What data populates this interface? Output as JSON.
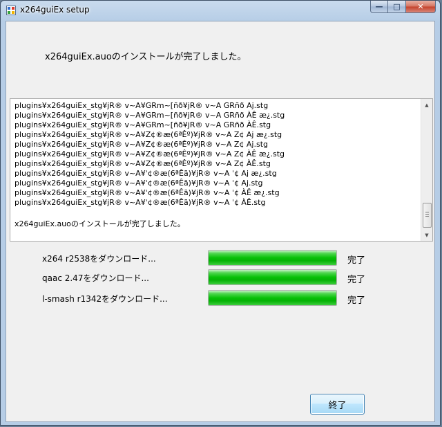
{
  "window": {
    "title": "x264guiEx setup",
    "caption": {
      "minimize": "—",
      "maximize": "□",
      "close": "✕"
    }
  },
  "header": {
    "message": "x264guiEx.auoのインストールが完了しました。"
  },
  "log": {
    "lines": [
      "plugins¥x264guiEx_stg¥jR® v~A¥GRm~[ñð¥jR® v~A GRñð Aj.stg",
      "plugins¥x264guiEx_stg¥jR® v~A¥GRm~[ñð¥jR® v~A GRñð ÀÊ æ¿.stg",
      "plugins¥x264guiEx_stg¥jR® v~A¥GRm~[ñð¥jR® v~A GRñð ÀÊ.stg",
      "plugins¥x264guiEx_stg¥jR® v~A¥Z¢®æ(6ªÊº)¥jR® v~A Z¢ Aj æ¿.stg",
      "plugins¥x264guiEx_stg¥jR® v~A¥Z¢®æ(6ªÊº)¥jR® v~A Z¢ Aj.stg",
      "plugins¥x264guiEx_stg¥jR® v~A¥Z¢®æ(6ªÊº)¥jR® v~A Z¢ ÀÊ æ¿.stg",
      "plugins¥x264guiEx_stg¥jR® v~A¥Z¢®æ(6ªÊº)¥jR® v~A Z¢ ÀÊ.stg",
      "plugins¥x264guiEx_stg¥jR® v~A¥ˈ¢®æ(6ªÊã)¥jR® v~A ˈ¢ Aj æ¿.stg",
      "plugins¥x264guiEx_stg¥jR® v~A¥ˈ¢®æ(6ªÊã)¥jR® v~A ˈ¢ Aj.stg",
      "plugins¥x264guiEx_stg¥jR® v~A¥ˈ¢®æ(6ªÊã)¥jR® v~A ˈ¢ ÀÊ æ¿.stg",
      "plugins¥x264guiEx_stg¥jR® v~A¥ˈ¢®æ(6ªÊã)¥jR® v~A ˈ¢ ÀÊ.stg"
    ],
    "final": "x264guiEx.auoのインストールが完了しました。"
  },
  "downloads": [
    {
      "label": "x264 r2538をダウンロード...",
      "status": "完了",
      "progress": 1.0
    },
    {
      "label": "qaac 2.47をダウンロード...",
      "status": "完了",
      "progress": 1.0
    },
    {
      "label": "l-smash r1342をダウンロード...",
      "status": "完了",
      "progress": 1.0
    }
  ],
  "buttons": {
    "finish": "終了"
  },
  "colors": {
    "progress_fill": "#07c107",
    "window_frame": "#b6cde6",
    "button_border": "#3c7fb1"
  }
}
